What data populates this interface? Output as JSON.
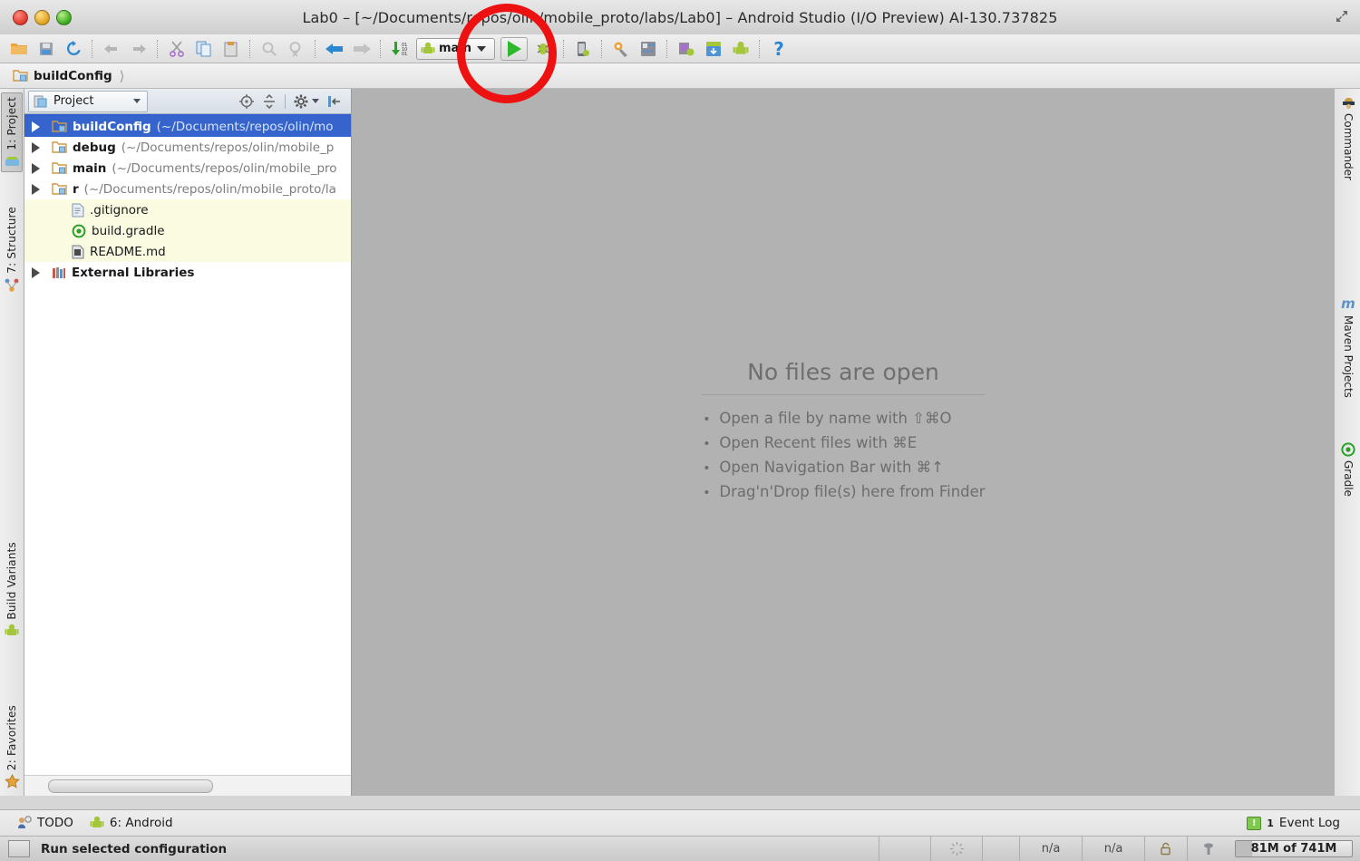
{
  "window": {
    "title": "Lab0 – [~/Documents/repos/olin/mobile_proto/labs/Lab0] – Android Studio (I/O Preview) AI-130.737825",
    "traffic_lights": [
      "close-button",
      "minimize-button",
      "zoom-button"
    ],
    "expand_icon": "expand-diagonal-icon"
  },
  "toolbar": {
    "icons": [
      {
        "name": "open-project-icon",
        "glyph": "folder"
      },
      {
        "name": "save-all-icon",
        "glyph": "floppy"
      },
      {
        "name": "sync-refresh-icon",
        "glyph": "sync"
      },
      {
        "name": "undo-icon",
        "glyph": "arrow-left"
      },
      {
        "name": "redo-icon",
        "glyph": "arrow-right"
      },
      {
        "name": "cut-icon",
        "glyph": "scissors"
      },
      {
        "name": "copy-icon",
        "glyph": "copy"
      },
      {
        "name": "paste-icon",
        "glyph": "clipboard"
      },
      {
        "name": "find-icon",
        "glyph": "magnifier"
      },
      {
        "name": "replace-icon",
        "glyph": "magnifier-replace"
      },
      {
        "name": "back-icon",
        "glyph": "arrow-back"
      },
      {
        "name": "forward-icon",
        "glyph": "arrow-forward"
      },
      {
        "name": "compile-icon",
        "glyph": "make-project"
      }
    ],
    "run_config": {
      "label": "main",
      "caret": "chevron-down-icon"
    },
    "run_button": "run-button",
    "debug_button": "debug-button",
    "right_icons": [
      {
        "name": "attach-debugger-icon"
      },
      {
        "name": "sdk-manager-icon"
      },
      {
        "name": "avd-manager-icon"
      },
      {
        "name": "android-monitor-icon"
      },
      {
        "name": "sdk-update-icon"
      },
      {
        "name": "android-icon"
      },
      {
        "name": "help-icon",
        "glyph": "?"
      }
    ]
  },
  "navbar": {
    "crumb_label": "buildConfig",
    "crumb_icon": "folder-module-icon",
    "crumb_separator": "chevron-right-icon"
  },
  "left_stripe": {
    "tabs": [
      {
        "label": "1: Project",
        "icon": "project-icon",
        "active": true
      },
      {
        "label": "7: Structure",
        "icon": "structure-icon",
        "active": false
      },
      {
        "label": "Build Variants",
        "icon": "android-icon",
        "active": false
      },
      {
        "label": "2: Favorites",
        "icon": "star-icon",
        "active": false
      }
    ]
  },
  "right_stripe": {
    "tabs": [
      {
        "label": "Commander",
        "icon": "commander-icon"
      },
      {
        "label": "Maven Projects",
        "icon": "maven-icon"
      },
      {
        "label": "Gradle",
        "icon": "gradle-icon"
      }
    ]
  },
  "project_panel": {
    "combo_label": "Project",
    "combo_icon": "project-view-icon",
    "tools": [
      {
        "name": "scroll-from-source-icon"
      },
      {
        "name": "collapse-all-icon"
      },
      {
        "name": "settings-gear-icon"
      },
      {
        "name": "hide-panel-icon"
      }
    ],
    "tree": [
      {
        "name": "buildConfig",
        "path": "(~/Documents/repos/olin/mo",
        "expandable": true,
        "selected": true,
        "scope": false,
        "icon": "folder-module-icon"
      },
      {
        "name": "debug",
        "path": "(~/Documents/repos/olin/mobile_p",
        "expandable": true,
        "selected": false,
        "scope": false,
        "icon": "folder-module-icon"
      },
      {
        "name": "main",
        "path": "(~/Documents/repos/olin/mobile_pro",
        "expandable": true,
        "selected": false,
        "scope": false,
        "icon": "folder-module-icon"
      },
      {
        "name": "r",
        "path": "(~/Documents/repos/olin/mobile_proto/la",
        "expandable": true,
        "selected": false,
        "scope": false,
        "icon": "folder-module-icon"
      },
      {
        "name": ".gitignore",
        "path": "",
        "expandable": false,
        "selected": false,
        "scope": true,
        "icon": "text-file-icon"
      },
      {
        "name": "build.gradle",
        "path": "",
        "expandable": false,
        "selected": false,
        "scope": true,
        "icon": "gradle-icon"
      },
      {
        "name": "README.md",
        "path": "",
        "expandable": false,
        "selected": false,
        "scope": true,
        "icon": "markdown-file-icon"
      },
      {
        "name": "External Libraries",
        "path": "",
        "expandable": true,
        "selected": false,
        "scope": false,
        "icon": "libraries-icon"
      }
    ]
  },
  "editor": {
    "empty_title": "No files are open",
    "hints": [
      "Open a file by name with ⇧⌘O",
      "Open Recent files with ⌘E",
      "Open Navigation Bar with ⌘↑",
      "Drag'n'Drop file(s) here from Finder"
    ]
  },
  "toolwindow_bar": {
    "items": [
      {
        "label": "TODO",
        "icon": "todo-icon"
      },
      {
        "label": "6: Android",
        "icon": "android-icon"
      }
    ],
    "event_log": {
      "label": "Event Log",
      "count": "1",
      "icon": "event-log-icon"
    }
  },
  "statusbar": {
    "message": "Run selected configuration",
    "toggle_icon": "toolwindow-toggle-icon",
    "cells": [
      {
        "name": "background-tasks-cell",
        "label": ""
      },
      {
        "name": "progress-spinner-cell",
        "label": ""
      },
      {
        "name": "blank-cell",
        "label": ""
      },
      {
        "name": "line-separator-cell",
        "label": "n/a"
      },
      {
        "name": "encoding-cell",
        "label": "n/a"
      },
      {
        "name": "lock-cell",
        "label": ""
      },
      {
        "name": "hector-cell",
        "label": ""
      }
    ],
    "memory": "81M of 741M"
  },
  "annotation": {
    "name": "red-highlight-circle",
    "color": "#ee1111"
  },
  "colors": {
    "selection_blue": "#3565cc",
    "scope_yellow": "#fbfbe2",
    "editor_gray": "#b2b2b2",
    "android_green": "#a4c639",
    "run_green": "#2eb82e",
    "annotation_red": "#ee1111"
  }
}
